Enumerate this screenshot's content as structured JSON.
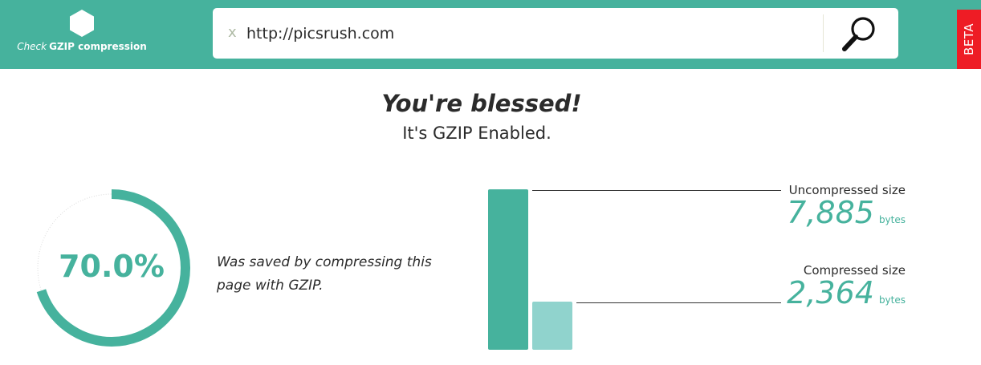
{
  "header": {
    "tagline_lite": "Check",
    "tagline_bold": "GZIP compression",
    "search": {
      "clear_label": "x",
      "url_value": "http://picsrush.com"
    },
    "beta_label": "BETA"
  },
  "result": {
    "headline": "You're blessed!",
    "subhead": "It's GZIP Enabled."
  },
  "savings": {
    "percent_label": "70.0%",
    "percent_value": 70.0,
    "description": "Was saved by compressing this page with GZIP."
  },
  "sizes": {
    "uncompressed": {
      "label": "Uncompressed size",
      "value_text": "7,885",
      "value": 7885,
      "unit": "bytes"
    },
    "compressed": {
      "label": "Compressed size",
      "value_text": "2,364",
      "value": 2364,
      "unit": "bytes"
    }
  },
  "colors": {
    "accent": "#46b29d",
    "accent_light": "#90d3cd",
    "beta": "#ee1c25",
    "ring_track": "#dcdcdc"
  },
  "icons": {
    "logo": "hexagon-logo-icon",
    "search": "magnifier-search-icon"
  }
}
